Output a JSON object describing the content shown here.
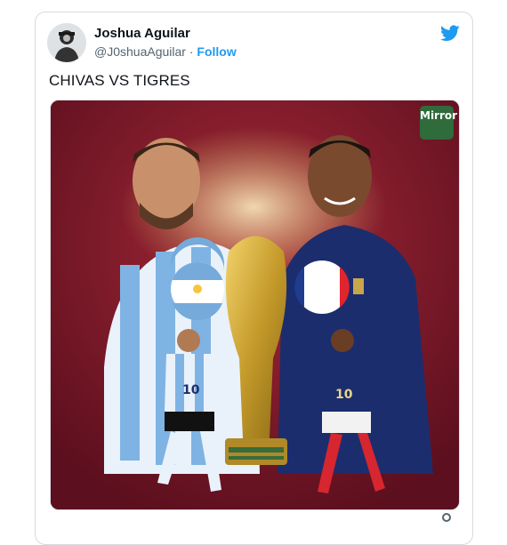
{
  "tweet": {
    "display_name": "Joshua Aguilar",
    "handle": "@J0shuaAguilar",
    "separator": "·",
    "follow_label": "Follow",
    "text": "CHIVAS VS TIGRES",
    "media": {
      "watermark_text": "Mirror",
      "player_left_number": "10",
      "player_right_number": "10"
    }
  },
  "colors": {
    "follow": "#1d9bf0",
    "media_background": "#7a1a2a",
    "argentina_blue": "#75aadb",
    "france_navy": "#1c2d6e"
  },
  "icons": {
    "twitter_logo": "twitter-bird-icon",
    "avatar": "avatar-image"
  }
}
